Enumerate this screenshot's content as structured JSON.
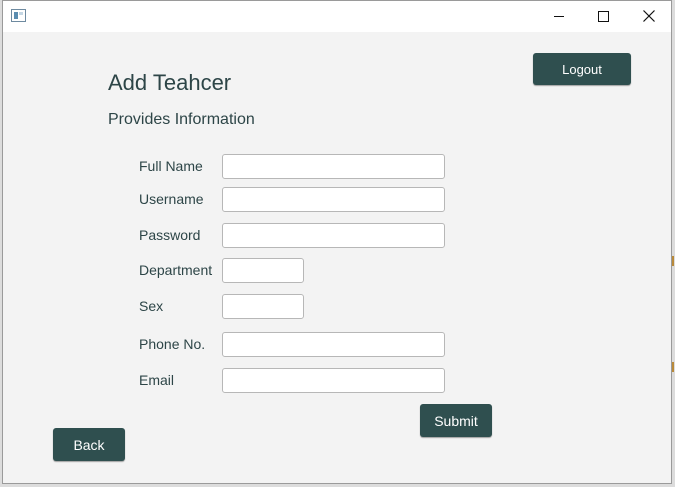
{
  "window": {
    "title": ""
  },
  "form": {
    "heading": "Add Teahcer",
    "subheading": "Provides Information",
    "fields": [
      {
        "label": "Full Name",
        "value": "",
        "placeholder": ""
      },
      {
        "label": "Username",
        "value": "",
        "placeholder": ""
      },
      {
        "label": "Password",
        "value": "",
        "placeholder": ""
      },
      {
        "label": "Department",
        "value": "",
        "placeholder": ""
      },
      {
        "label": "Sex",
        "value": "",
        "placeholder": ""
      },
      {
        "label": "Phone No.",
        "value": "",
        "placeholder": ""
      },
      {
        "label": "Email",
        "value": "",
        "placeholder": ""
      }
    ]
  },
  "buttons": {
    "logout": "Logout",
    "submit": "Submit",
    "back": "Back"
  },
  "icons": {
    "app": "app-window-icon",
    "minimize": "minimize-icon",
    "maximize": "maximize-icon",
    "close": "close-icon"
  },
  "colors": {
    "accent": "#2f4f4f",
    "text": "#2d4547",
    "background": "#f3f3f3"
  }
}
